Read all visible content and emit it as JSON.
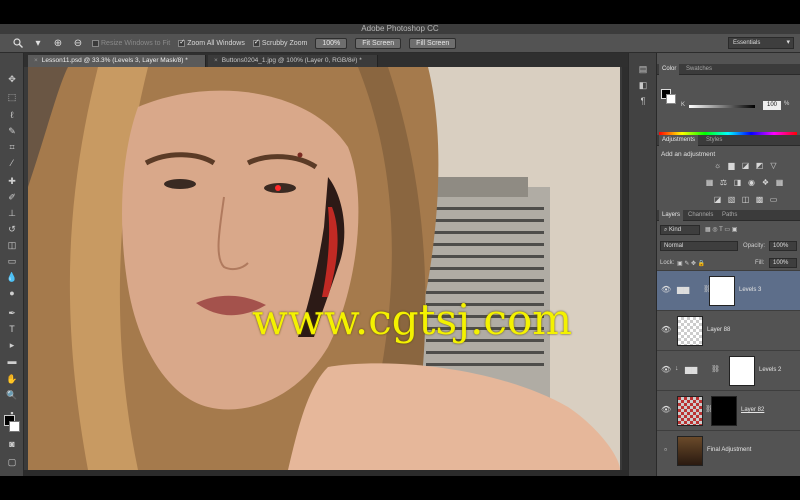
{
  "app": {
    "title": "Adobe Photoshop CC"
  },
  "options_bar": {
    "tool_icon": "zoom-icon",
    "resize_windows": "Resize Windows to Fit",
    "resize_windows_checked": false,
    "zoom_all_windows": "Zoom All Windows",
    "zoom_all_windows_checked": true,
    "scrubby_zoom": "Scrubby Zoom",
    "scrubby_zoom_checked": true,
    "btn_100": "100%",
    "btn_fit": "Fit Screen",
    "btn_fill": "Fill Screen",
    "workspace": "Essentials"
  },
  "doc_tabs": [
    {
      "label": "Lesson11.psd @ 33.3% (Levels 3, Layer Mask/8) *",
      "active": true
    },
    {
      "label": "Buttons0204_1.jpg @ 100% (Layer 0, RGB/8#) *",
      "active": false
    }
  ],
  "canvas": {
    "watermark": "www.cgtsj.com"
  },
  "color_panel": {
    "tabs": [
      "Color",
      "Swatches"
    ],
    "k_value": "100",
    "k_unit": "%"
  },
  "adjustments_panel": {
    "tabs": [
      "Adjustments",
      "Styles"
    ],
    "title": "Add an adjustment"
  },
  "layers_panel": {
    "tabs": [
      "Layers",
      "Channels",
      "Paths"
    ],
    "filter_kind": "Kind",
    "blend_mode": "Normal",
    "opacity_label": "Opacity:",
    "opacity_value": "100%",
    "lock_label": "Lock:",
    "fill_label": "Fill:",
    "fill_value": "100%",
    "layers": [
      {
        "name": "Levels 3",
        "selected": true,
        "type": "adjustment"
      },
      {
        "name": "Layer 88",
        "selected": false,
        "type": "pixel"
      },
      {
        "name": "Levels 2",
        "selected": false,
        "type": "adjustment"
      },
      {
        "name": "Layer 82",
        "selected": false,
        "type": "masked"
      },
      {
        "name": "Final Adjustment",
        "selected": false,
        "type": "group"
      }
    ]
  },
  "colors": {
    "ui_gray": "#535353",
    "selected_layer": "#5d6e8a",
    "watermark": "#f4f200"
  }
}
